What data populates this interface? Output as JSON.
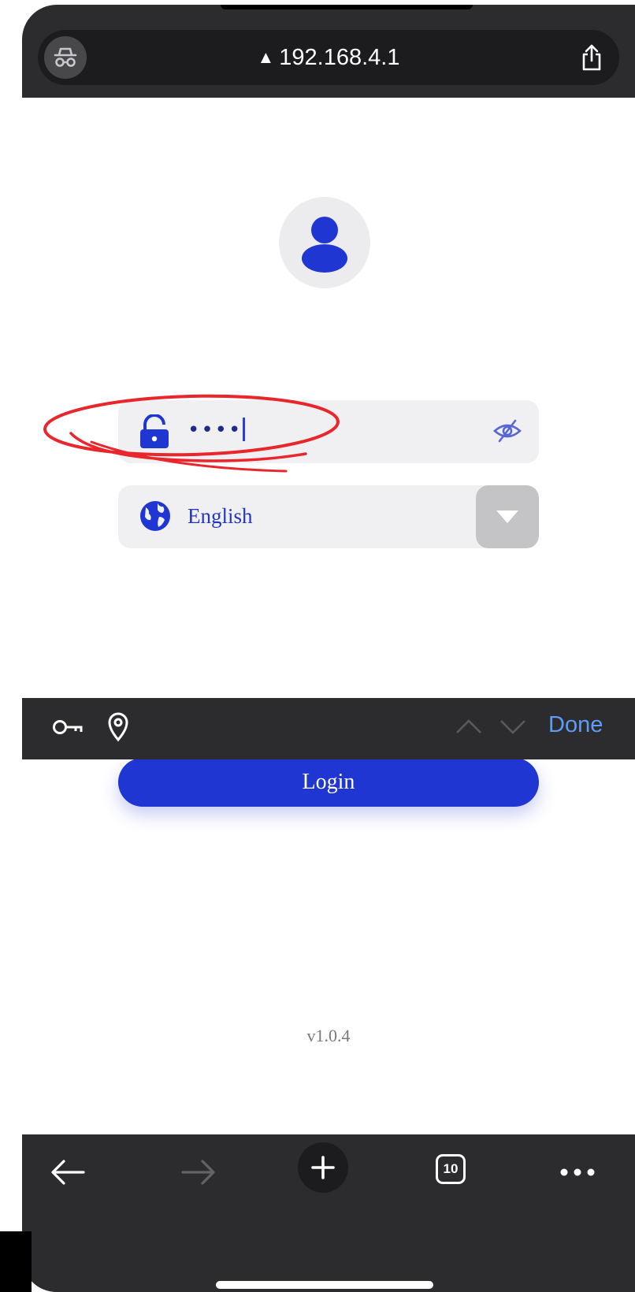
{
  "browser": {
    "url": "192.168.4.1",
    "url_warning_icon": "warning-triangle-icon",
    "incognito_icon": "incognito-icon",
    "share_icon": "share-icon"
  },
  "login_form": {
    "avatar_icon": "user-icon",
    "password": {
      "value": "••••",
      "icon": "lock-icon",
      "toggle_icon": "eye-off-icon"
    },
    "language": {
      "selected": "English",
      "icon": "globe-icon",
      "dropdown_icon": "caret-down-icon"
    },
    "login_label": "Login",
    "version": "v1.0.4"
  },
  "keyboard_bar": {
    "done_label": "Done",
    "icons": [
      "key-icon",
      "location-pin-icon",
      "chevron-up-icon",
      "chevron-down-icon"
    ]
  },
  "toolbar": {
    "tab_count": "10",
    "icons": [
      "back-arrow-icon",
      "forward-arrow-icon",
      "plus-icon",
      "tabs-icon",
      "more-icon"
    ]
  },
  "colors": {
    "accent": "#1f36d3",
    "annotation": "#e8262b",
    "chrome": "#2c2c2e",
    "done_link": "#5e9cf5"
  }
}
